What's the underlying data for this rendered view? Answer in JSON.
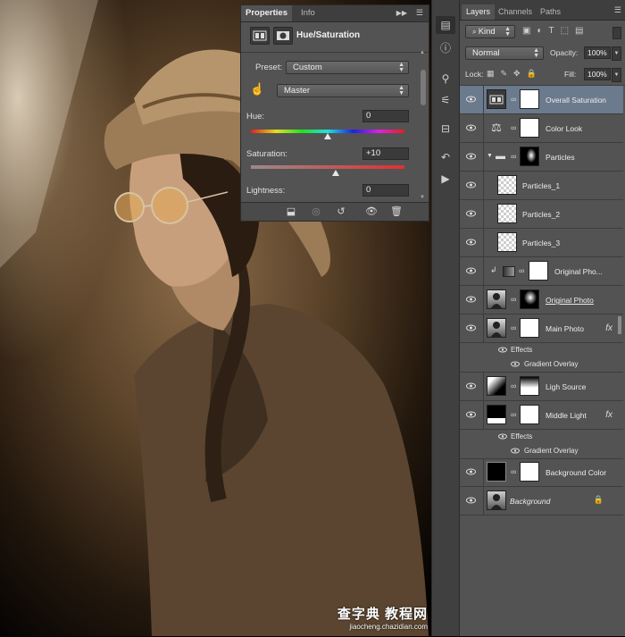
{
  "properties_panel": {
    "tabs": [
      "Properties",
      "Info"
    ],
    "title": "Hue/Saturation",
    "preset_label": "Preset:",
    "preset_value": "Custom",
    "channel_value": "Master",
    "hue_label": "Hue:",
    "hue_value": "0",
    "saturation_label": "Saturation:",
    "saturation_value": "+10",
    "lightness_label": "Lightness:",
    "lightness_value": "0"
  },
  "layers_panel": {
    "tabs": [
      "Layers",
      "Channels",
      "Paths"
    ],
    "filter_label": "Kind",
    "blend_mode": "Normal",
    "opacity_label": "Opacity:",
    "opacity_value": "100%",
    "lock_label": "Lock:",
    "fill_label": "Fill:",
    "fill_value": "100%",
    "layers": [
      {
        "name": "Overall Saturation"
      },
      {
        "name": "Color Look"
      },
      {
        "name": "Particles"
      },
      {
        "name": "Particles_1"
      },
      {
        "name": "Particles_2"
      },
      {
        "name": "Particles_3"
      },
      {
        "name": "Original Pho..."
      },
      {
        "name": "Original Photo"
      },
      {
        "name": "Main Photo",
        "effects_label": "Effects",
        "effect": "Gradient Overlay"
      },
      {
        "name": "Ligh Source"
      },
      {
        "name": "Middle Light",
        "effects_label": "Effects",
        "effect": "Gradient Overlay"
      },
      {
        "name": "Background Color"
      },
      {
        "name": "Background"
      }
    ]
  },
  "watermark": {
    "line1": "查字典 教程网",
    "line2": "jiaocheng.chazidian.com"
  }
}
